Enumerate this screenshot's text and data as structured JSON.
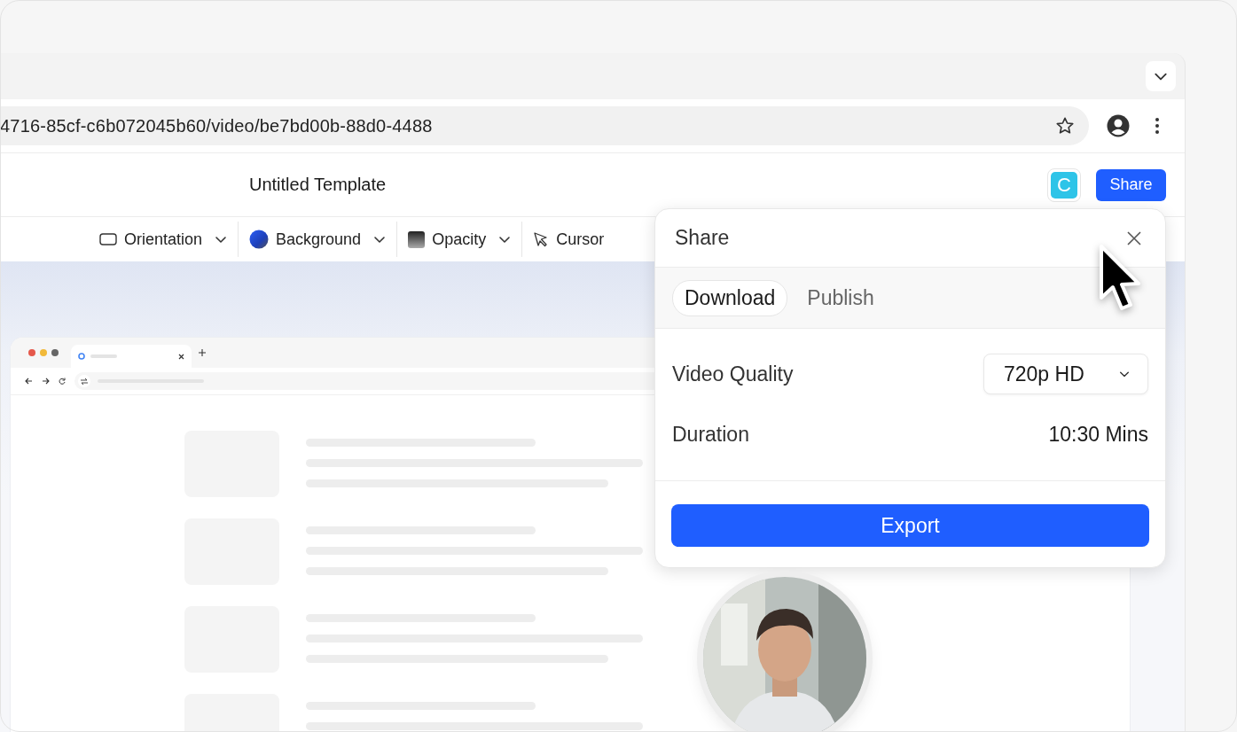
{
  "browser": {
    "address": "4716-85cf-c6b072045b60/video/be7bd00b-88d0-4488"
  },
  "app_header": {
    "title": "Untitled Template",
    "avatar_letter": "C",
    "share_button": "Share"
  },
  "toolbar": [
    {
      "label": "Orientation",
      "kind": "orientation",
      "has_menu": true
    },
    {
      "label": "Background",
      "kind": "background",
      "has_menu": true
    },
    {
      "label": "Opacity",
      "kind": "opacity",
      "has_menu": true
    },
    {
      "label": "Cursor",
      "kind": "cursor",
      "has_menu": false
    }
  ],
  "share_panel": {
    "title": "Share",
    "tabs": [
      {
        "label": "Download",
        "selected": true
      },
      {
        "label": "Publish",
        "selected": false
      }
    ],
    "fields": [
      {
        "label": "Video Quality",
        "value": "720p HD",
        "kind": "select"
      },
      {
        "label": "Duration",
        "value": "10:30 Mins",
        "kind": "text"
      }
    ],
    "export_button": "Export"
  }
}
